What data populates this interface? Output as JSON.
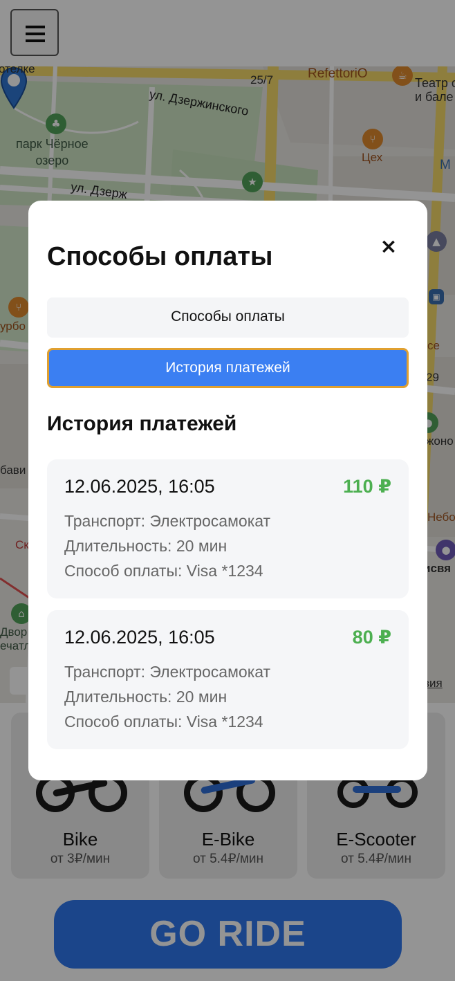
{
  "header": {
    "menu_icon": "hamburger-icon"
  },
  "map": {
    "labels": {
      "hotel": "отелке",
      "park": "парк Чёрное\nозеро",
      "refettorio": "RefettoriO",
      "theatre": "Театр опе\nи бале",
      "tseh": "Цех",
      "m": "М",
      "burg": "урбо",
      "bava": "бави",
      "dvor": "Двор\nечатл",
      "nebo": "Небо",
      "sse": "се",
      "n29": "29",
      "zhono": "жоно",
      "svya": "исвя",
      "sk": "Ск",
      "n257": "25/7",
      "yandex": "вия"
    },
    "streets": {
      "dzerzh_top": "ул. Дзержинского",
      "dzerzh_mid": "ул. Дзерж"
    }
  },
  "vehicles": [
    {
      "name": "Bike",
      "price": "от 3₽/мин"
    },
    {
      "name": "E-Bike",
      "price": "от 5.4₽/мин"
    },
    {
      "name": "E-Scooter",
      "price": "от 5.4₽/мин"
    }
  ],
  "go_button": "GO RIDE",
  "modal": {
    "title": "Способы оплаты",
    "close": "×",
    "tabs": {
      "methods": "Способы оплаты",
      "history": "История платежей"
    },
    "section_title": "История платежей",
    "payments": [
      {
        "date": "12.06.2025, 16:05",
        "amount": "110 ₽",
        "transport": "Транспорт: Электросамокат",
        "duration": "Длительность: 20 мин",
        "method": "Способ оплаты: Visa *1234"
      },
      {
        "date": "12.06.2025, 16:05",
        "amount": "80 ₽",
        "transport": "Транспорт: Электросамокат",
        "duration": "Длительность: 20 мин",
        "method": "Способ оплаты: Visa *1234"
      }
    ]
  },
  "colors": {
    "accent": "#3b7ff2",
    "amount": "#4caf50",
    "go": "#2f78ee",
    "tab_border": "#e0a030"
  }
}
